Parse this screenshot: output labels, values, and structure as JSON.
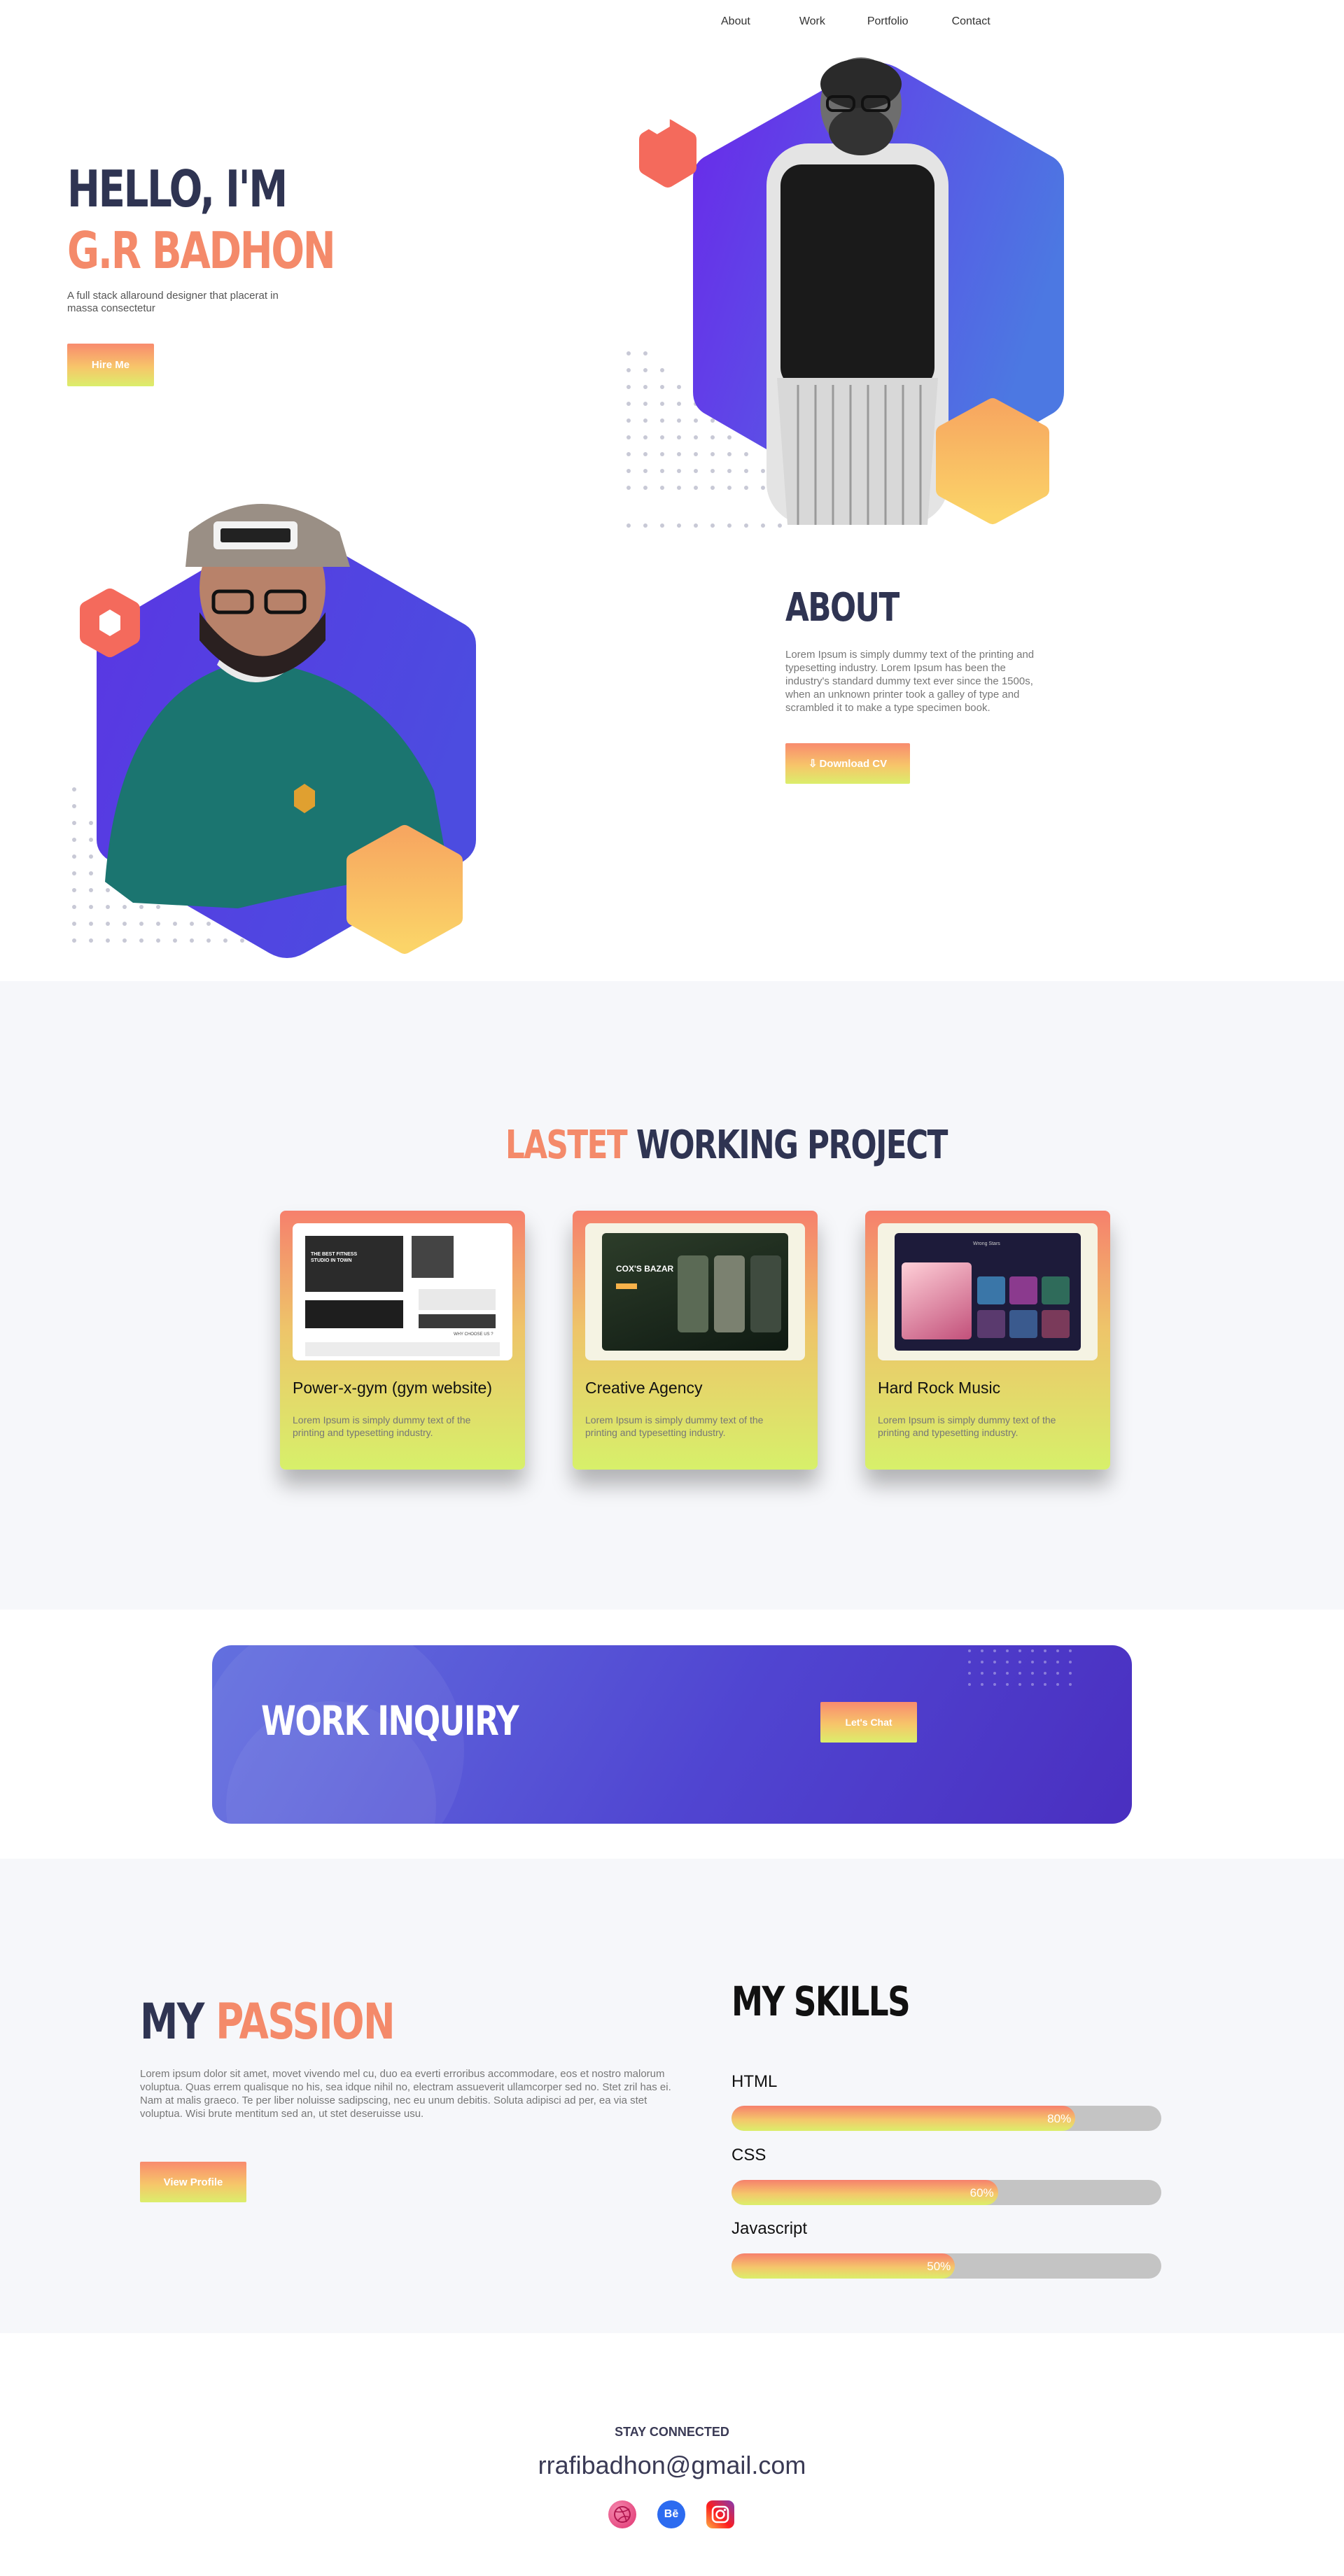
{
  "nav": {
    "items": [
      {
        "label": "About"
      },
      {
        "label": "Work"
      },
      {
        "label": "Portfolio"
      },
      {
        "label": "Contact"
      }
    ]
  },
  "hero": {
    "greeting": "HELLO, I'M",
    "name": "G.R BADHON",
    "tagline": "A full stack allaround designer that placerat in massa consectetur",
    "hire_label": "Hire Me"
  },
  "about": {
    "title": "ABOUT",
    "text": "Lorem Ipsum is simply dummy text of the printing and typesetting industry. Lorem Ipsum has been the industry's standard dummy text ever since the 1500s, when an unknown printer took a galley of type and scrambled it to make a type specimen book.",
    "download_label": "Download CV"
  },
  "projects": {
    "title_accent": "LASTET",
    "title_rest": "WORKING PROJECT",
    "cards": [
      {
        "title": "Power-x-gym (gym website)",
        "desc": "Lorem Ipsum is simply dummy text of the printing and typesetting industry.",
        "shot_title": "THE BEST FITNESS STUDIO IN TOWN",
        "shot_caption": "WHY CHOOSE US ?"
      },
      {
        "title": "Creative Agency",
        "desc": "Lorem Ipsum is simply dummy text of the printing and typesetting industry.",
        "shot_title": "COX'S BAZAR"
      },
      {
        "title": "Hard Rock Music",
        "desc": "Lorem Ipsum is simply dummy text of the printing and typesetting industry.",
        "shot_title": "Wrong Stars"
      }
    ]
  },
  "inquiry": {
    "title": "WORK INQUIRY",
    "chat_label": "Let's Chat"
  },
  "passion": {
    "title_plain": "MY",
    "title_accent": "PASSION",
    "text": "Lorem ipsum dolor sit amet, movet vivendo mel cu, duo ea everti erroribus accommodare, eos et nostro malorum voluptua. Quas errem qualisque no his, sea idque nihil no, electram assueverit ullamcorper sed no. Stet zril has ei. Nam at malis graeco. Te per liber noluisse sadipscing, nec eu unum debitis. Soluta adipisci ad per, ea via stet voluptua. Wisi brute mentitum sed an, ut stet deseruisse usu.",
    "profile_label": "View Profile"
  },
  "skills": {
    "title": "MY SKILLS",
    "items": [
      {
        "name": "HTML",
        "value": 80,
        "label": "80%"
      },
      {
        "name": "CSS",
        "value": 60,
        "label": "60%"
      },
      {
        "name": "Javascript",
        "value": 50,
        "label": "50%"
      }
    ]
  },
  "footer": {
    "stay": "STAY CONNECTED",
    "email": "rrafibadhon@gmail.com",
    "social": [
      {
        "icon": "dribbble-icon"
      },
      {
        "icon": "behance-icon",
        "text": "Bē"
      },
      {
        "icon": "instagram-icon"
      }
    ]
  },
  "colors": {
    "accent": "#f48a6a",
    "dark": "#2f3452",
    "purple": "#5b3fe0",
    "bg": "#f6f7fa"
  }
}
